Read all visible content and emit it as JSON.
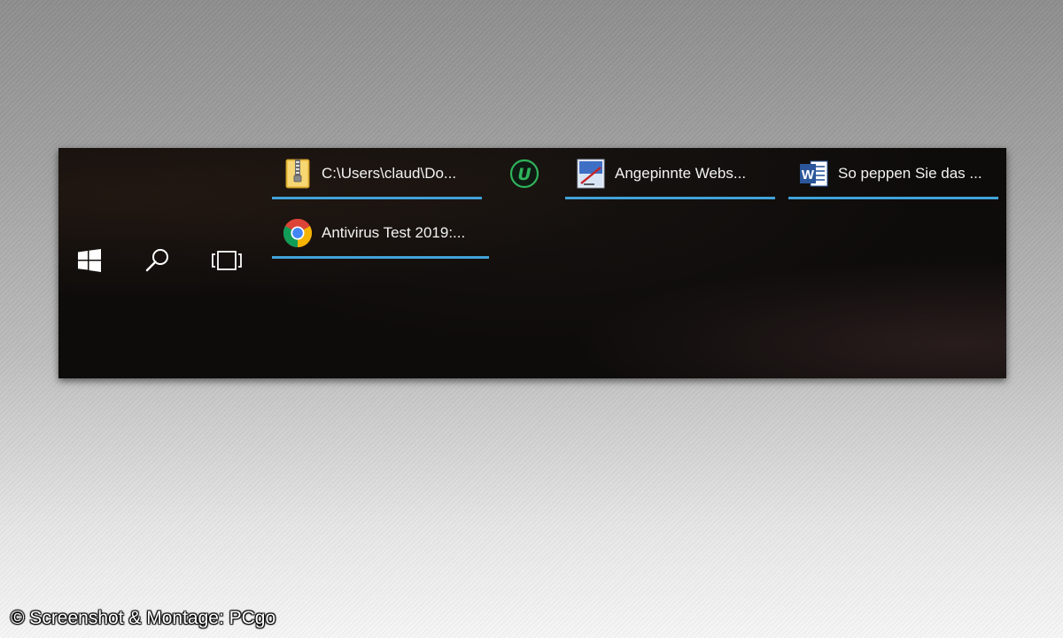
{
  "taskbar": {
    "system_buttons": [
      {
        "name": "start",
        "icon": "windows-logo-icon"
      },
      {
        "name": "search",
        "icon": "search-icon"
      },
      {
        "name": "task-view",
        "icon": "task-view-icon"
      }
    ],
    "tasks": [
      {
        "label": "C:\\Users\\claud\\Do...",
        "icon": "winzip-folder-icon",
        "active": true
      },
      {
        "label": "",
        "icon": "u-green-circle-icon",
        "active": false
      },
      {
        "label": "Angepinnte Webs...",
        "icon": "pinned-website-icon",
        "active": true
      },
      {
        "label": "So peppen Sie das ...",
        "icon": "word-icon",
        "active": true
      },
      {
        "label": "Antivirus Test 2019:...",
        "icon": "chrome-icon",
        "active": true
      }
    ],
    "accent_color": "#41a2d8"
  },
  "credit": "© Screenshot & Montage: PCgo"
}
